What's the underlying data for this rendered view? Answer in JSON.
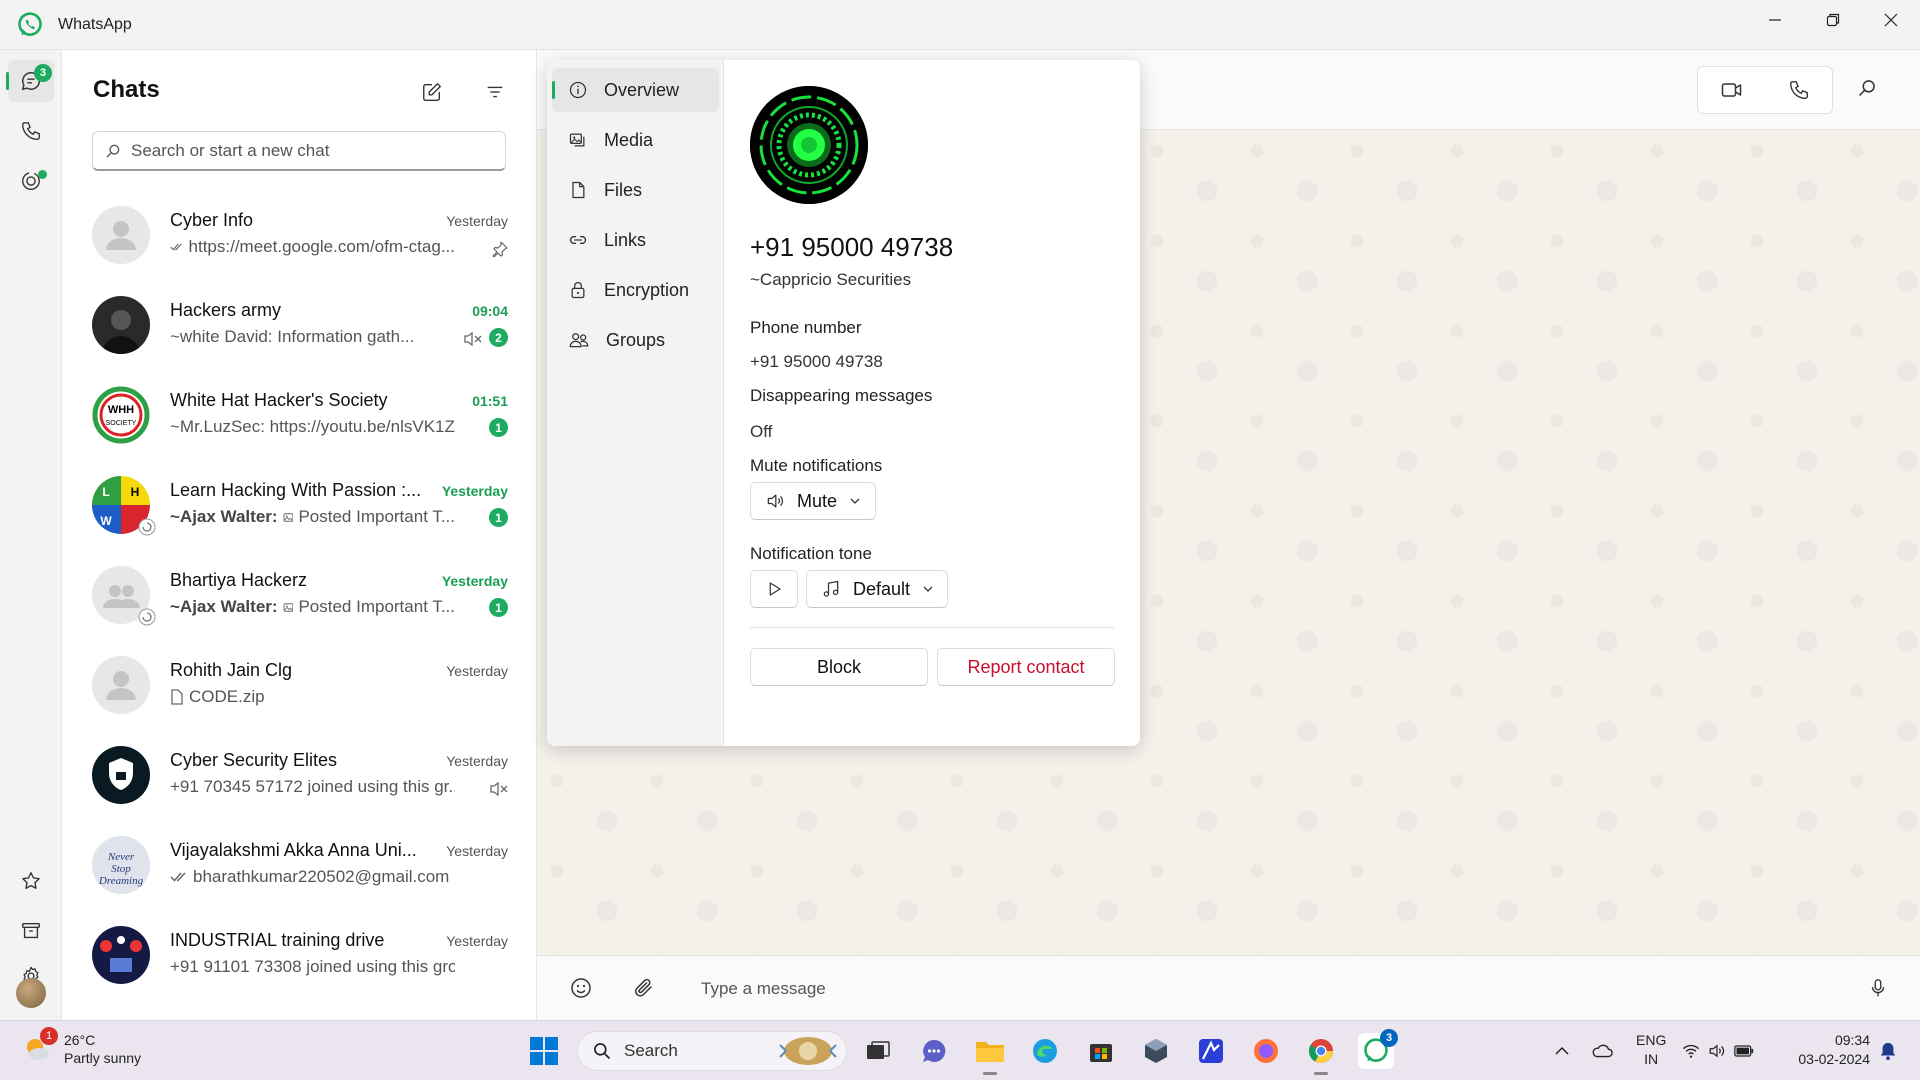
{
  "window": {
    "title": "WhatsApp"
  },
  "rail": {
    "chats_badge": "3"
  },
  "chat_list": {
    "title": "Chats",
    "search_placeholder": "Search or start a new chat",
    "chats": [
      {
        "name": "Cyber Info",
        "time": "Yesterday",
        "unread": false,
        "sender": "",
        "preview": "https://meet.google.com/ofm-ctag...",
        "badge": "",
        "ticks": true,
        "pinned": true,
        "muted": false,
        "attachment": ""
      },
      {
        "name": "Hackers army",
        "time": "09:04",
        "unread": true,
        "sender": "",
        "preview": "~white David: Information gath...",
        "badge": "2",
        "ticks": false,
        "pinned": false,
        "muted": true,
        "attachment": "image"
      },
      {
        "name": "White Hat Hacker's Society",
        "time": "01:51",
        "unread": true,
        "sender": "",
        "preview": "~Mr.LuzSec: https://youtu.be/nlsVK1Z...",
        "badge": "1",
        "ticks": false,
        "pinned": false,
        "muted": false,
        "attachment": ""
      },
      {
        "name": "Learn Hacking With Passion :...",
        "time": "Yesterday",
        "unread": true,
        "sender": "~Ajax Walter:",
        "preview": "Posted Important T...",
        "badge": "1",
        "ticks": false,
        "pinned": false,
        "muted": false,
        "attachment": "image"
      },
      {
        "name": "Bhartiya Hackerz",
        "time": "Yesterday",
        "unread": true,
        "sender": "~Ajax Walter:",
        "preview": "Posted Important T...",
        "badge": "1",
        "ticks": false,
        "pinned": false,
        "muted": false,
        "attachment": "image"
      },
      {
        "name": "Rohith Jain Clg",
        "time": "Yesterday",
        "unread": false,
        "sender": "",
        "preview": "CODE.zip",
        "badge": "",
        "ticks": false,
        "pinned": false,
        "muted": false,
        "attachment": "file"
      },
      {
        "name": "Cyber Security Elites",
        "time": "Yesterday",
        "unread": false,
        "sender": "",
        "preview": "+91 70345 57172 joined using this gr...",
        "badge": "",
        "ticks": false,
        "pinned": false,
        "muted": true,
        "attachment": ""
      },
      {
        "name": "Vijayalakshmi Akka Anna Uni...",
        "time": "Yesterday",
        "unread": false,
        "sender": "",
        "preview": "bharathkumar220502@gmail.com",
        "badge": "",
        "ticks": true,
        "pinned": false,
        "muted": false,
        "attachment": ""
      },
      {
        "name": "INDUSTRIAL training drive",
        "time": "Yesterday",
        "unread": false,
        "sender": "",
        "preview": "+91 91101 73308 joined using this gro...",
        "badge": "",
        "ticks": false,
        "pinned": false,
        "muted": false,
        "attachment": ""
      }
    ]
  },
  "composer": {
    "placeholder": "Type a message"
  },
  "contact_info": {
    "nav": [
      "Overview",
      "Media",
      "Files",
      "Links",
      "Encryption",
      "Groups"
    ],
    "phone_title": "+91 95000 49738",
    "about": "~Cappricio Securities",
    "phone_label": "Phone number",
    "phone_value": "+91 95000 49738",
    "disappearing_label": "Disappearing messages",
    "disappearing_value": "Off",
    "mute_label": "Mute notifications",
    "mute_button": "Mute",
    "tone_label": "Notification tone",
    "tone_value": "Default",
    "block_button": "Block",
    "report_button": "Report contact",
    "report_color": "#c8102e"
  },
  "taskbar": {
    "weather_temp": "26°C",
    "weather_desc": "Partly sunny",
    "weather_badge": "1",
    "search_label": "Search",
    "whatsapp_badge": "3",
    "lang_line1": "ENG",
    "lang_line2": "IN",
    "time": "09:34",
    "date": "03-02-2024"
  },
  "colors": {
    "accent": "#1daa61",
    "unread_time": "#1a9e54"
  }
}
